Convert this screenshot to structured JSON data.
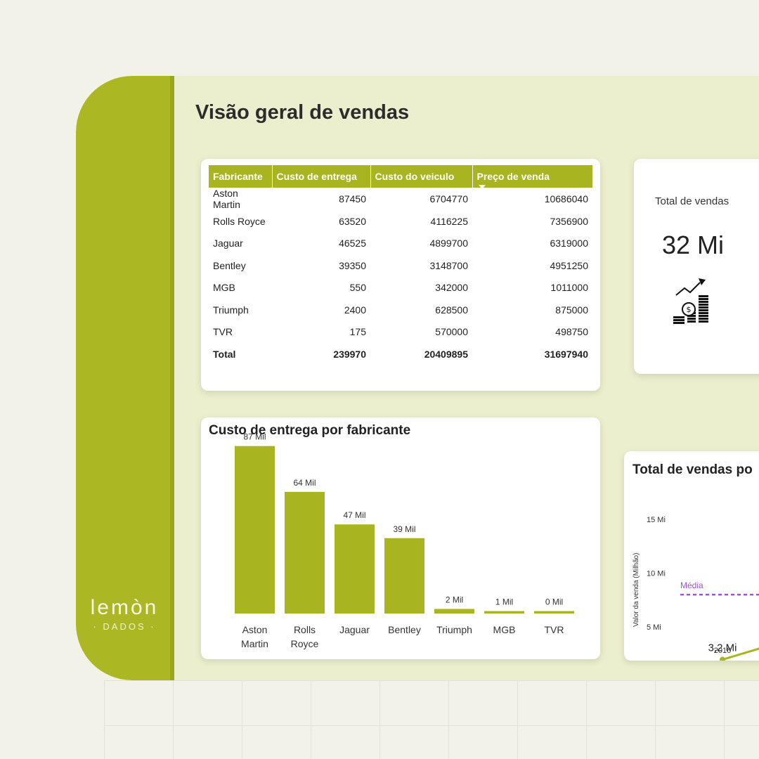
{
  "page_title": "Visão geral de vendas",
  "logo": {
    "name": "lemòn",
    "subtitle": "· DADOS ·"
  },
  "table": {
    "columns": [
      "Fabricante",
      "Custo de entrega",
      "Custo do veiculo",
      "Preço de venda"
    ],
    "rows": [
      [
        "Aston Martin",
        "87450",
        "6704770",
        "10686040"
      ],
      [
        "Rolls Royce",
        "63520",
        "4116225",
        "7356900"
      ],
      [
        "Jaguar",
        "46525",
        "4899700",
        "6319000"
      ],
      [
        "Bentley",
        "39350",
        "3148700",
        "4951250"
      ],
      [
        "MGB",
        "550",
        "342000",
        "1011000"
      ],
      [
        "Triumph",
        "2400",
        "628500",
        "875000"
      ],
      [
        "TVR",
        "175",
        "570000",
        "498750"
      ]
    ],
    "total": [
      "Total",
      "239970",
      "20409895",
      "31697940"
    ]
  },
  "kpi": {
    "label": "Total de vendas",
    "value": "32 Mi",
    "icon": "money-growth-icon"
  },
  "colors": {
    "accent": "#abb823",
    "bar": "#a8b520",
    "media_line": "#a44ee0"
  },
  "chart_data": [
    {
      "type": "bar",
      "title": "Custo de entrega por fabricante",
      "categories": [
        "Aston Martin",
        "Rolls Royce",
        "Jaguar",
        "Bentley",
        "Triumph",
        "MGB",
        "TVR"
      ],
      "category_lines": [
        [
          "Aston",
          "Martin"
        ],
        [
          "Rolls",
          "Royce"
        ],
        [
          "Jaguar"
        ],
        [
          "Bentley"
        ],
        [
          "Triumph"
        ],
        [
          "MGB"
        ],
        [
          "TVR"
        ]
      ],
      "values": [
        87450,
        63520,
        46525,
        39350,
        2400,
        550,
        175
      ],
      "data_labels": [
        "87 Mil",
        "64 Mil",
        "47 Mil",
        "39 Mil",
        "2 Mil",
        "1 Mil",
        "0 Mil"
      ],
      "ylim": [
        0,
        100000
      ]
    },
    {
      "type": "line",
      "title": "Total de vendas po",
      "ylabel": "Valor da venda (Milhão)",
      "ytick_labels": [
        "15 Mi",
        "10 Mi",
        "5 Mi"
      ],
      "yticks": [
        15,
        10,
        5
      ],
      "x": [
        "2016"
      ],
      "values": [
        3.2
      ],
      "point_labels": [
        "3,2 Mi"
      ],
      "average_label": "Média",
      "average_value": 8
    }
  ]
}
